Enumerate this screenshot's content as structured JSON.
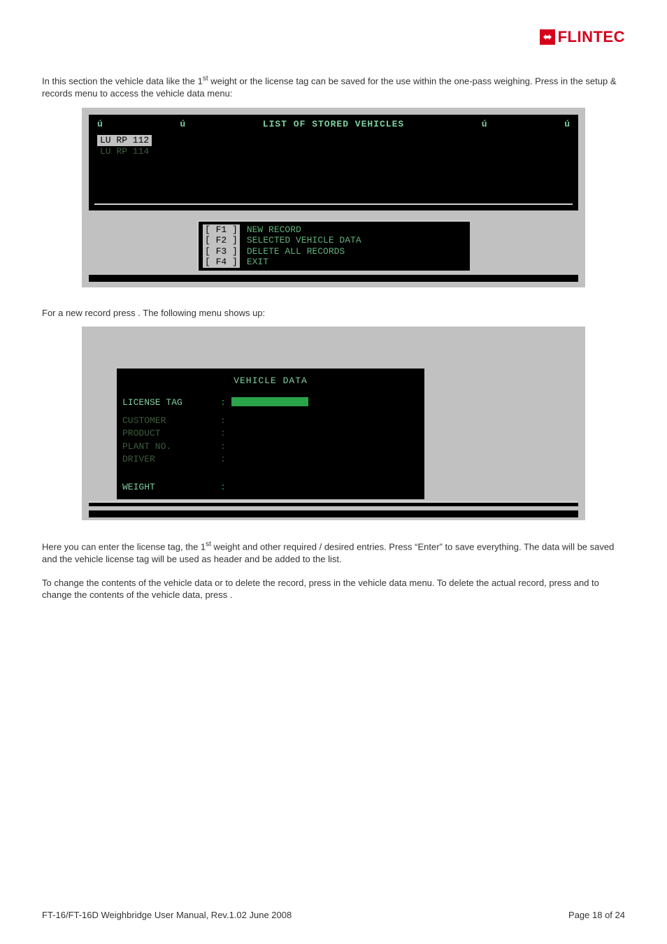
{
  "logo": {
    "text": "FLINTEC"
  },
  "para1_a": "In this section the vehicle data like the 1",
  "para1_sup": "st",
  "para1_b": " weight or the license tag can be saved for the use within the one-pass weighing. Press ",
  "para1_c": " in the setup & records menu to access the vehicle data menu:",
  "term1": {
    "title": "LIST OF STORED VEHICLES",
    "u": "ú",
    "rows": [
      "LU RP 112",
      "LU RP 114"
    ],
    "fkeys": [
      {
        "key": "[ F1 ]",
        "label": "NEW RECORD"
      },
      {
        "key": "[ F2 ]",
        "label": "SELECTED VEHICLE DATA"
      },
      {
        "key": "[ F3 ]",
        "label": "DELETE ALL RECORDS"
      },
      {
        "key": "[ F4 ]",
        "label": "EXIT"
      }
    ]
  },
  "para2": "For a new record press        . The following menu shows up:",
  "term2": {
    "title": "VEHICLE DATA",
    "fields": [
      {
        "label": "LICENSE TAG",
        "kind": "input"
      },
      {
        "label": "CUSTOMER",
        "kind": "blank"
      },
      {
        "label": "PRODUCT",
        "kind": "blank"
      },
      {
        "label": "PLANT NO.",
        "kind": "blank"
      },
      {
        "label": "DRIVER",
        "kind": "blank"
      },
      {
        "label": "",
        "kind": "spacer"
      },
      {
        "label": "WEIGHT",
        "kind": "blank"
      }
    ]
  },
  "para3_a": "Here you can enter the license tag, the 1",
  "para3_sup": "st",
  "para3_b": " weight and other required / desired entries. Press “Enter” to save everything. The data will be saved and the vehicle license tag will be used as header and be added to the list.",
  "para4": "To change the contents of the vehicle data or to delete the record, press        in the vehicle data menu. To delete the actual record, press          and to change the contents of the vehicle data, press          .",
  "footer_left": "FT-16/FT-16D Weighbridge User Manual, Rev.1.02   June 2008",
  "footer_right": "Page 18 of 24"
}
